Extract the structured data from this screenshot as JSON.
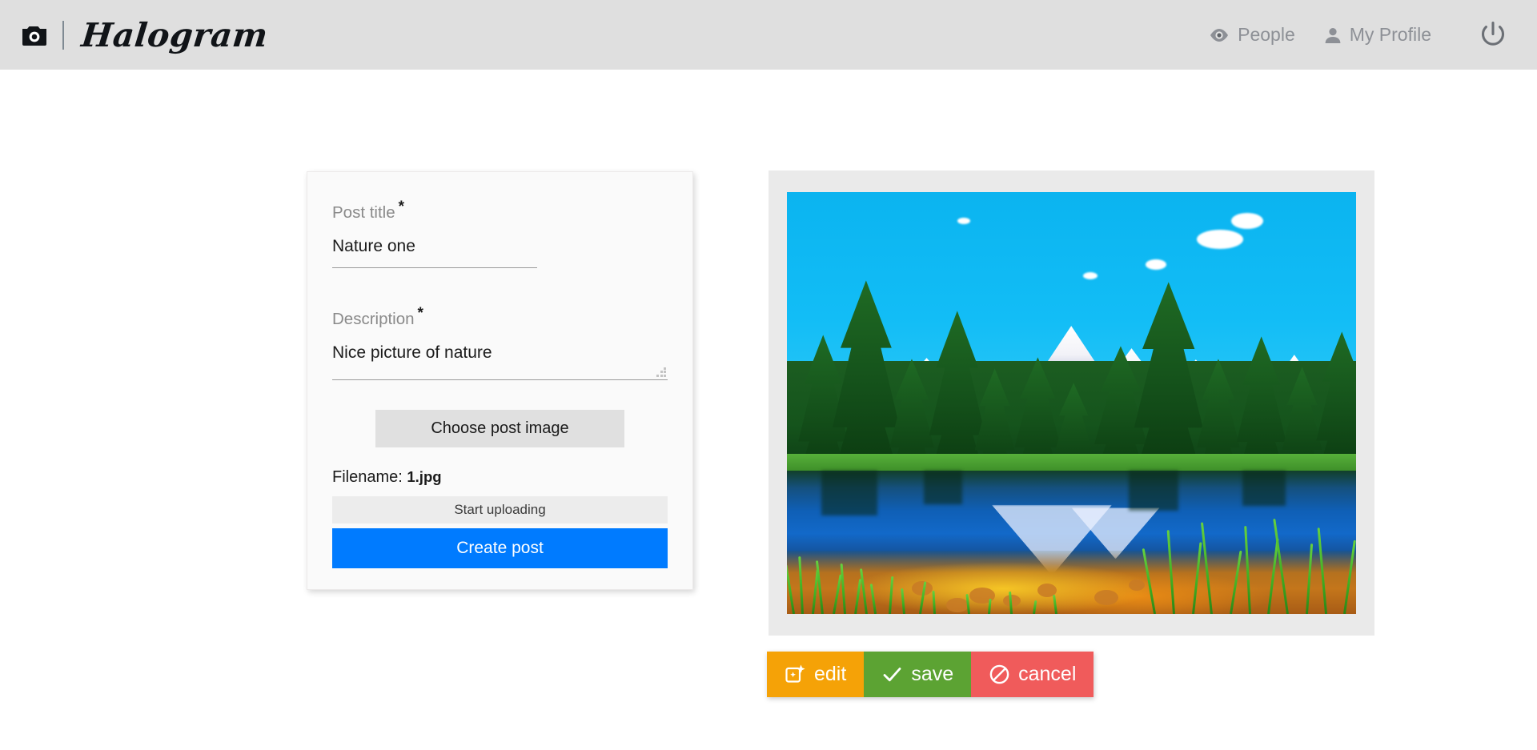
{
  "header": {
    "logo_icon": "camera-icon",
    "brand": "Halogram",
    "nav": [
      {
        "label": "People",
        "icon": "eye-icon"
      },
      {
        "label": "My Profile",
        "icon": "person-icon"
      }
    ],
    "logout_icon": "power-icon",
    "background": "#dfdfdf"
  },
  "form": {
    "title_label": "Post title",
    "title_required": "*",
    "title_value": "Nature one",
    "title_placeholder": "Post title",
    "description_label": "Description",
    "description_required": "*",
    "description_value": "Nice picture of nature",
    "description_placeholder": "Description",
    "choose_image_label": "Choose post image",
    "filename_label": "Filename:",
    "filename_value": "1.jpg",
    "upload_label": "Start uploading",
    "submit_label": "Create post",
    "submit_color": "#007bff"
  },
  "preview": {
    "image_alt": "Mountain lake with evergreen forest, snowy peaks and golden pebbles",
    "panel_background": "#eaeaea"
  },
  "actions": [
    {
      "label": "edit",
      "icon": "image-edit-icon",
      "color": "#f5a207"
    },
    {
      "label": "save",
      "icon": "check-icon",
      "color": "#5ca333"
    },
    {
      "label": "cancel",
      "icon": "ban-icon",
      "color": "#f05b5b"
    }
  ]
}
